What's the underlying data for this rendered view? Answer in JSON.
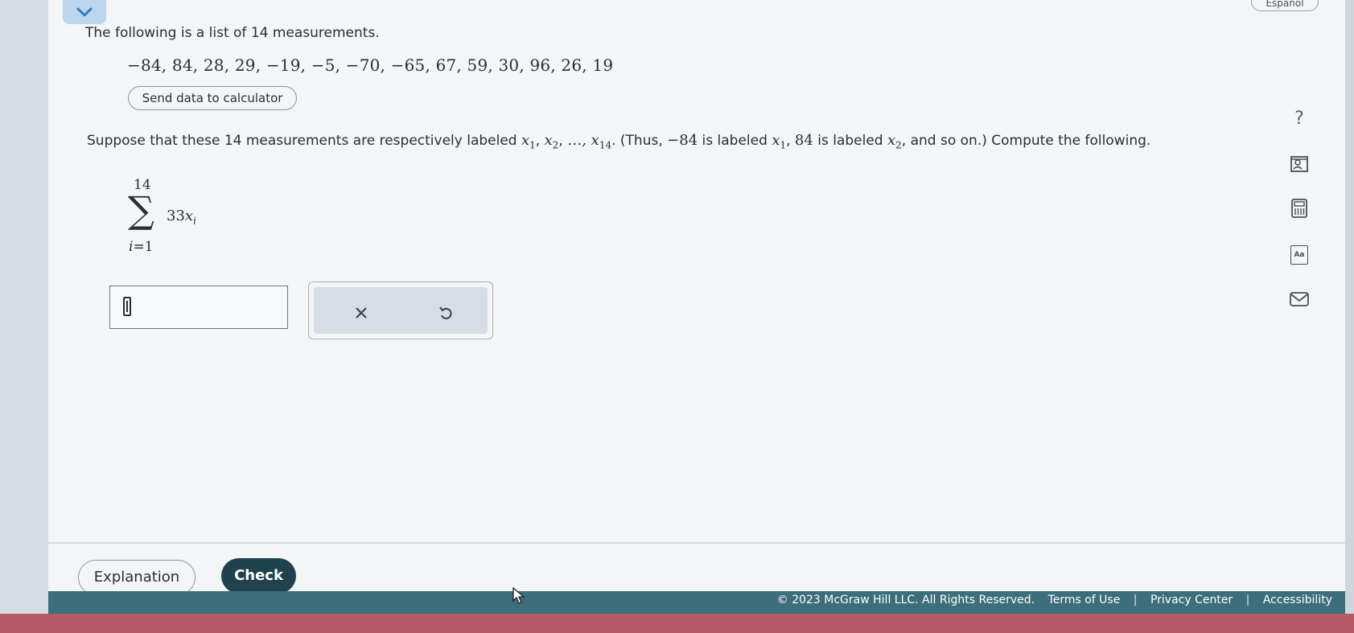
{
  "header": {
    "collapse_icon": "chevron-down-icon",
    "language_label": "Español"
  },
  "problem": {
    "intro": "The following is a list of 14 measurements.",
    "data_values": "−84, 84, 28, 29, −19, −5, −70, −65, 67, 59, 30, 96, 26, 19",
    "send_button": "Send data to calculator",
    "question_part1": "Suppose that these 14 measurements are respectively labeled ",
    "var_x": "x",
    "sub1": "1",
    "sub2": "2",
    "sub14": "14",
    "comma": ", ",
    "ellipsis": "…, ",
    "question_part2": ". (Thus, ",
    "neg84": "−84",
    "is_labeled": " is labeled ",
    "comma_sp": ", ",
    "pos84": "84",
    "question_part3": ", and so on.) Compute the following.",
    "sum_upper": "14",
    "sum_symbol": "∑",
    "sum_lower_var": "i",
    "sum_lower_rest": "=1",
    "sum_coeff": "33",
    "sum_var": "x",
    "sum_sub": "i"
  },
  "answer": {
    "value": "",
    "clear_icon": "close-icon",
    "undo_icon": "undo-icon"
  },
  "toolbar": {
    "help_icon": "question-icon",
    "help_label": "?",
    "tools": [
      "ebook-icon",
      "calculator-icon",
      "text-size-icon",
      "mail-icon"
    ],
    "text_size_label": "Aa"
  },
  "footer": {
    "explanation": "Explanation",
    "check": "Check",
    "copyright": "© 2023 McGraw Hill LLC. All Rights Reserved.",
    "terms": "Terms of Use",
    "privacy": "Privacy Center",
    "accessibility": "Accessibility",
    "separator": "|"
  }
}
